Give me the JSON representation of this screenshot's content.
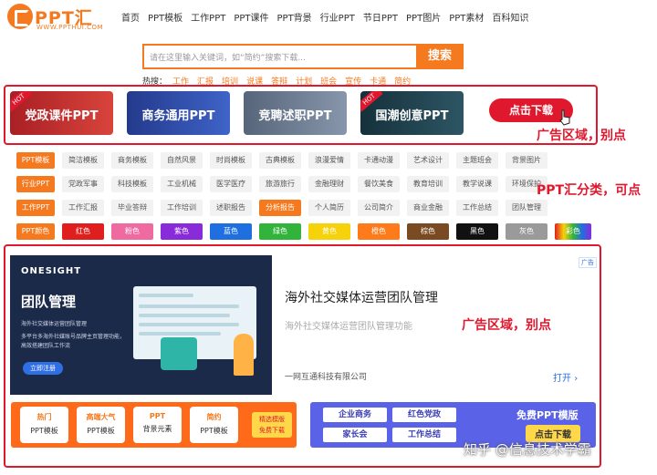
{
  "logo": {
    "name": "PPT汇",
    "url": "WWW.PPTHUI.COM"
  },
  "nav": [
    "首页",
    "PPT模板",
    "工作PPT",
    "PPT课件",
    "PPT背景",
    "行业PPT",
    "节日PPT",
    "PPT图片",
    "PPT素材",
    "百科知识"
  ],
  "search": {
    "placeholder": "请在这里输入关键词，如“简约”搜索下载...",
    "button": "搜索"
  },
  "hot": {
    "label": "热搜：",
    "keywords": [
      "工作",
      "汇报",
      "培训",
      "说课",
      "答辩",
      "计划",
      "班会",
      "宣传",
      "卡通",
      "简约"
    ]
  },
  "banners": [
    {
      "label": "党政课件PPT",
      "badge": "HOT",
      "color": "#b3262a"
    },
    {
      "label": "商务通用PPT",
      "badge": "",
      "color": "#2f4fb0"
    },
    {
      "label": "竞聘述职PPT",
      "badge": "",
      "color": "#6e7f95"
    },
    {
      "label": "国潮创意PPT",
      "badge": "HOT",
      "color": "#1f3e4a"
    }
  ],
  "download_button": "点击下载",
  "notes": {
    "ad_top": "广告区域，别点",
    "categories": "PPT汇分类，可点",
    "ad_main": "广告区域，别点"
  },
  "categories": [
    {
      "head": "PPT模板",
      "items": [
        "简洁模板",
        "商务模板",
        "自然风景",
        "时尚模板",
        "古典模板",
        "浪漫爱情",
        "卡通动漫",
        "艺术设计",
        "主题班会",
        "背景图片"
      ]
    },
    {
      "head": "行业PPT",
      "items": [
        "党政军事",
        "科技模板",
        "工业机械",
        "医学医疗",
        "旅游旅行",
        "金融理财",
        "餐饮美食",
        "教育培训",
        "教学说课",
        "环境保护"
      ]
    },
    {
      "head": "工作PPT",
      "items": [
        "工作汇报",
        "毕业答辩",
        "工作培训",
        "述职报告",
        "分析报告",
        "个人简历",
        "公司简介",
        "商业金融",
        "工作总结",
        "团队管理"
      ],
      "active": 4
    },
    {
      "head": "PPT颜色",
      "colors": [
        {
          "label": "红色",
          "color": "#e11e1e"
        },
        {
          "label": "粉色",
          "color": "#f06aa2"
        },
        {
          "label": "紫色",
          "color": "#8a2bd9"
        },
        {
          "label": "蓝色",
          "color": "#1f6fe0"
        },
        {
          "label": "绿色",
          "color": "#32b43c"
        },
        {
          "label": "黄色",
          "color": "#f6d20a"
        },
        {
          "label": "橙色",
          "color": "#ff7a1a"
        },
        {
          "label": "棕色",
          "color": "#7a4a22"
        },
        {
          "label": "黑色",
          "color": "#111111"
        },
        {
          "label": "灰色",
          "color": "#9a9a9a"
        },
        {
          "label": "彩色",
          "color": "#6a3cc8"
        }
      ]
    }
  ],
  "ad": {
    "brand": "ONESIGHT",
    "image_title": "团队管理",
    "image_lines": [
      "海外社交媒体运营团队管理",
      "多平台多海外社媒账号品牌主页管理功能，",
      "高效搭建团队工作流"
    ],
    "register": "立即注册",
    "tag": "广告",
    "title": "海外社交媒体运营团队管理",
    "subtitle": "海外社交媒体运营团队管理功能",
    "company": "一网互通科技有限公司",
    "open": "打开"
  },
  "bottom_left": {
    "tiles": [
      [
        "热门",
        "PPT模板"
      ],
      [
        "高端大气",
        "PPT模板"
      ],
      [
        "PPT",
        "背景元素"
      ],
      [
        "简约",
        "PPT模板"
      ]
    ],
    "featured": [
      "精选模版",
      "免费下载"
    ]
  },
  "bottom_right": {
    "chips": [
      "企业商务",
      "红色党政",
      "家长会",
      "工作总结"
    ],
    "free": "免费PPT模版",
    "click": "点击下载"
  },
  "watermark": "知乎 @信息技术学霸"
}
